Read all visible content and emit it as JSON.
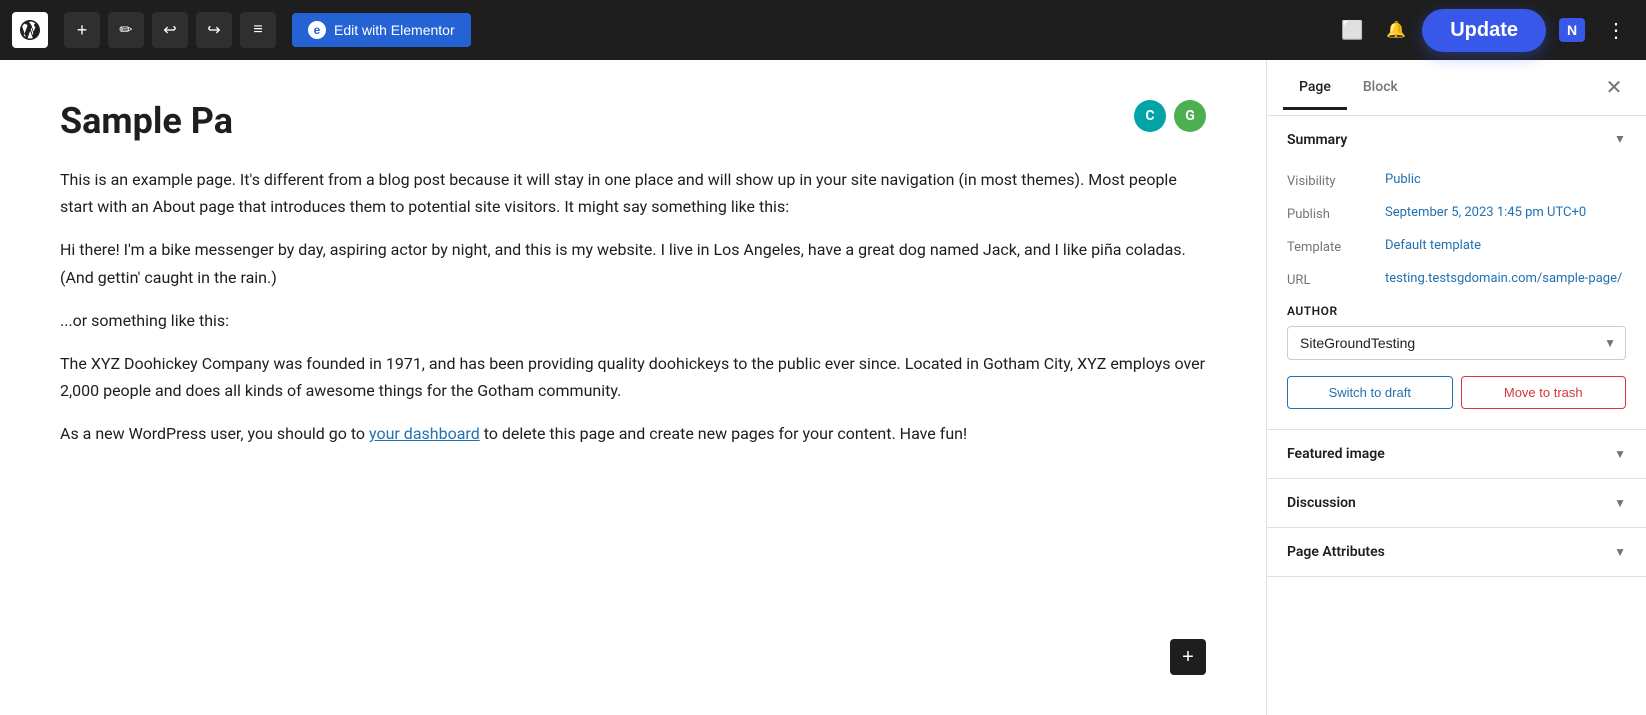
{
  "toolbar": {
    "wp_logo_alt": "WordPress",
    "add_label": "+",
    "edit_label": "✏",
    "undo_label": "↩",
    "redo_label": "↪",
    "list_label": "≡",
    "edit_elementor_label": "Edit with Elementor",
    "update_label": "Update",
    "view_icon_label": "⬜",
    "notification_label": "🔔",
    "n_label": "N",
    "more_label": "⋮"
  },
  "editor": {
    "page_title": "Sample Pa",
    "add_block_label": "+",
    "paragraph1": "This is an example page. It's different from a blog post because it will stay in one place and will show up in your site navigation (in most themes). Most people start with an About page that introduces them to potential site visitors. It might say something like this:",
    "paragraph2": "Hi there! I'm a bike messenger by day, aspiring actor by night, and this is my website. I live in Los Angeles, have a great dog named Jack, and I like piña coladas. (And gettin' caught in the rain.)",
    "paragraph3": "...or something like this:",
    "paragraph4_before": "The XYZ Doohickey Company was founded in 1971, and has been providing quality doohickeys to the public ever since. Located in Gotham City, XYZ employs over 2,000 people and does all kinds of awesome things for the Gotham community.",
    "paragraph5_before": "As a new WordPress user, you should go to ",
    "paragraph5_link": "your dashboard",
    "paragraph5_link_href": "#",
    "paragraph5_after": " to delete this page and create new pages for your content. Have fun!"
  },
  "sidebar": {
    "tab_page_label": "Page",
    "tab_block_label": "Block",
    "close_label": "✕",
    "summary_section_label": "Summary",
    "visibility_label": "Visibility",
    "visibility_value": "Public",
    "publish_label": "Publish",
    "publish_value": "September 5, 2023 1:45 pm UTC+0",
    "template_label": "Template",
    "template_value": "Default template",
    "url_label": "URL",
    "url_value": "testing.testsgdomain.com/sample-page/",
    "author_section_label": "AUTHOR",
    "author_select_value": "SiteGroundTesting",
    "author_options": [
      "SiteGroundTesting"
    ],
    "switch_draft_label": "Switch to draft",
    "move_trash_label": "Move to trash",
    "featured_image_label": "Featured image",
    "discussion_label": "Discussion",
    "page_attributes_label": "Page Attributes"
  }
}
